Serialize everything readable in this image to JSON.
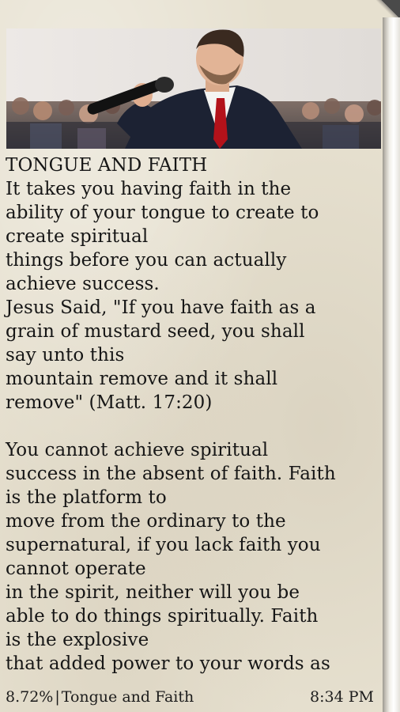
{
  "article": {
    "title": "TONGUE AND FAITH",
    "lines": [
      "It takes you having faith in the",
      "ability of your tongue to create to",
      "create spiritual",
      "things before you can actually",
      "achieve success.",
      "Jesus Said, \"If you have faith as a",
      "grain of mustard seed, you shall",
      "say unto this",
      "mountain remove and it shall",
      "remove\" (Matt. 17:20)",
      "",
      "You cannot achieve spiritual",
      "success in the absent of faith. Faith",
      "is the platform to",
      "move from the ordinary to the",
      "supernatural, if you lack faith you",
      "cannot operate",
      "in the spirit, neither will you be",
      "able to do things spiritually. Faith",
      "is the explosive",
      "that added power to your words as"
    ]
  },
  "status": {
    "progress": "8.72%",
    "separator": "|",
    "chapter": "Tongue and Faith",
    "time": "8:34 PM"
  },
  "header_image": {
    "subject": "speaker-with-microphone-photo"
  }
}
